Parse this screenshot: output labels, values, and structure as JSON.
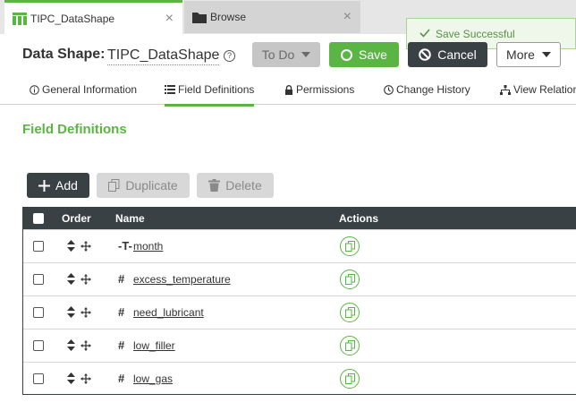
{
  "tabs": [
    {
      "label": "TIPC_DataShape",
      "active": true
    },
    {
      "label": "Browse",
      "active": false
    }
  ],
  "toast": {
    "message": "Save Successful"
  },
  "entity": {
    "type_label": "Data Shape:",
    "name": "TIPC_DataShape"
  },
  "toolbar": {
    "todo_label": "To Do",
    "save_label": "Save",
    "cancel_label": "Cancel",
    "more_label": "More"
  },
  "subnav": [
    {
      "label": "General Information",
      "icon": "info-icon"
    },
    {
      "label": "Field Definitions",
      "icon": "list-icon",
      "active": true
    },
    {
      "label": "Permissions",
      "icon": "lock-icon"
    },
    {
      "label": "Change History",
      "icon": "clock-icon"
    },
    {
      "label": "View Relation",
      "icon": "relation-icon"
    }
  ],
  "section": {
    "title": "Field Definitions"
  },
  "actions": {
    "add_label": "Add",
    "duplicate_label": "Duplicate",
    "delete_label": "Delete"
  },
  "grid": {
    "columns": [
      "Order",
      "Name",
      "Actions"
    ],
    "rows": [
      {
        "name": "month",
        "type_icon": "string-type-icon"
      },
      {
        "name": "excess_temperature",
        "type_icon": "number-type-icon"
      },
      {
        "name": "need_lubricant",
        "type_icon": "number-type-icon"
      },
      {
        "name": "low_filler",
        "type_icon": "number-type-icon"
      },
      {
        "name": "low_gas",
        "type_icon": "number-type-icon"
      }
    ]
  },
  "colors": {
    "accent": "#5bb544",
    "dark": "#3a4145",
    "disabled": "#d8d8d8"
  }
}
